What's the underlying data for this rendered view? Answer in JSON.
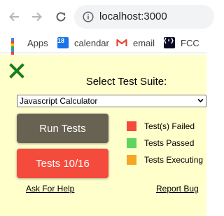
{
  "browser": {
    "url": "localhost:3000",
    "icons": {
      "back": "back-arrow-icon",
      "forward": "forward-arrow-icon",
      "reload": "reload-icon",
      "site_info": "info-icon"
    }
  },
  "bookmarks": [
    {
      "label": "Apps",
      "icon": "apps-grid-icon"
    },
    {
      "label": "calendar",
      "icon": "calendar-icon",
      "icon_text": "18"
    },
    {
      "label": "email",
      "icon": "gmail-icon"
    },
    {
      "label": "FCC",
      "icon": "freecodecamp-icon",
      "icon_text": "(🔥)"
    }
  ],
  "test_suite": {
    "title": "Select Test Suite:",
    "selected_suite": "Javascript Calculator",
    "run_button": "Run Tests",
    "tests_button": "Tests 10/16",
    "legend": [
      {
        "label": "Test(s) Failed",
        "color": "#f44b3d"
      },
      {
        "label": "Tests Passed",
        "color": "#5fd55f"
      },
      {
        "label": "Tests Executing",
        "color": "#f5a623"
      }
    ],
    "help_link": "Ask For Help",
    "bug_link": "Report Bug"
  },
  "colors": {
    "panel_bg": "#ffffcc",
    "close_icon": "#1a7f1a",
    "run_button_bg": "#686253",
    "tests_button_bg": "#f44b3d"
  }
}
